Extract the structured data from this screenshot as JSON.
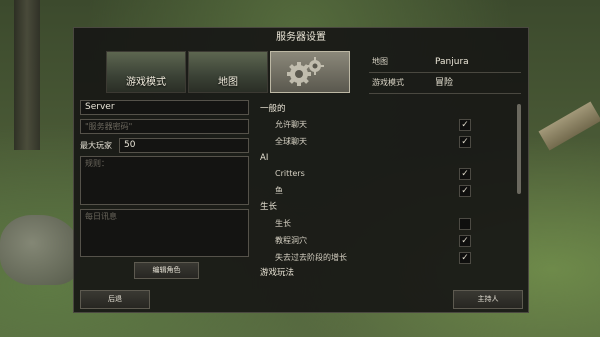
{
  "window": {
    "title": "服务器设置"
  },
  "tabs": [
    {
      "label": "游戏模式"
    },
    {
      "label": "地图"
    },
    {
      "label": ""
    }
  ],
  "info": {
    "map_label": "地图",
    "map_value": "Panjura",
    "mode_label": "游戏模式",
    "mode_value": "冒险"
  },
  "left": {
    "server_name": "Server",
    "password_placeholder": "\"服务器密码\"",
    "max_players_label": "最大玩家",
    "max_players_value": "50",
    "rules_placeholder": "规则：",
    "motd_placeholder": "每日讯息",
    "edit_roles_label": "编辑角色"
  },
  "settings": {
    "general_header": "一般的",
    "allow_chat": {
      "label": "允许聊天",
      "checked": true
    },
    "global_chat": {
      "label": "全球聊天",
      "checked": true
    },
    "ai_header": "AI",
    "critters": {
      "label": "Critters",
      "checked": true
    },
    "fish": {
      "label": "鱼",
      "checked": true
    },
    "growth_header": "生长",
    "growth": {
      "label": "生长",
      "checked": false
    },
    "tutorial_cave": {
      "label": "教程洞穴",
      "checked": true
    },
    "lose_stage_growth": {
      "label": "失去过去阶段的增长",
      "checked": true
    },
    "gameplay_header": "游戏玩法"
  },
  "footer": {
    "back_label": "后退",
    "host_label": "主持人"
  },
  "icons": {
    "checkmark": "checkmark-icon",
    "gear": "gear-icon"
  }
}
